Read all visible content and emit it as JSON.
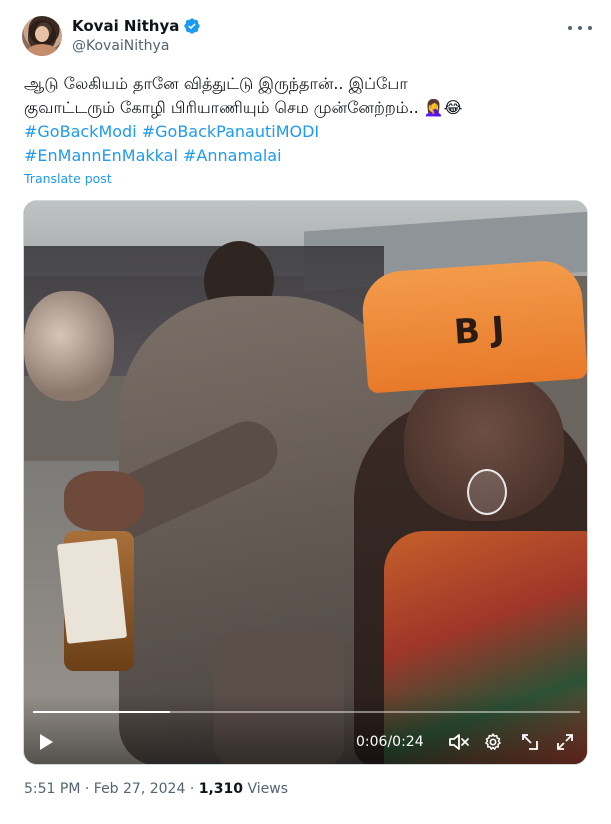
{
  "author": {
    "display_name": "Kovai Nithya",
    "handle": "@KovaiNithya",
    "verified": true
  },
  "tweet": {
    "line1": "ஆடு லேகியம் தானே வித்துட்டு இருந்தான்.. இப்போ",
    "line2": "குவாட்டரும் கோழி பிரியாணியும் செம முன்னேற்றம்..",
    "line2_emoji": "🤦‍♀️😂",
    "hashtags_line1": [
      "#GoBackModi",
      "#GoBackPanautiMODI"
    ],
    "hashtags_line2": [
      "#EnMannEnMakkal",
      "#Annamalai"
    ],
    "translate_label": "Translate post"
  },
  "video": {
    "current_time": "0:06",
    "separator": " / ",
    "duration": "0:24",
    "progress": 0.25,
    "cap_text": "B J"
  },
  "meta": {
    "time": "5:51 PM",
    "dot1": " · ",
    "date": "Feb 27, 2024",
    "dot2": " · ",
    "views_count": "1,310",
    "views_label": " Views"
  },
  "colors": {
    "link": "#1d9bf0",
    "text": "#0f1419",
    "secondary": "#536471",
    "border": "#cfd9de"
  },
  "icons": [
    "verified-badge-icon",
    "more-icon",
    "play-icon",
    "mute-icon",
    "gear-icon",
    "popout-icon",
    "fullscreen-icon"
  ]
}
